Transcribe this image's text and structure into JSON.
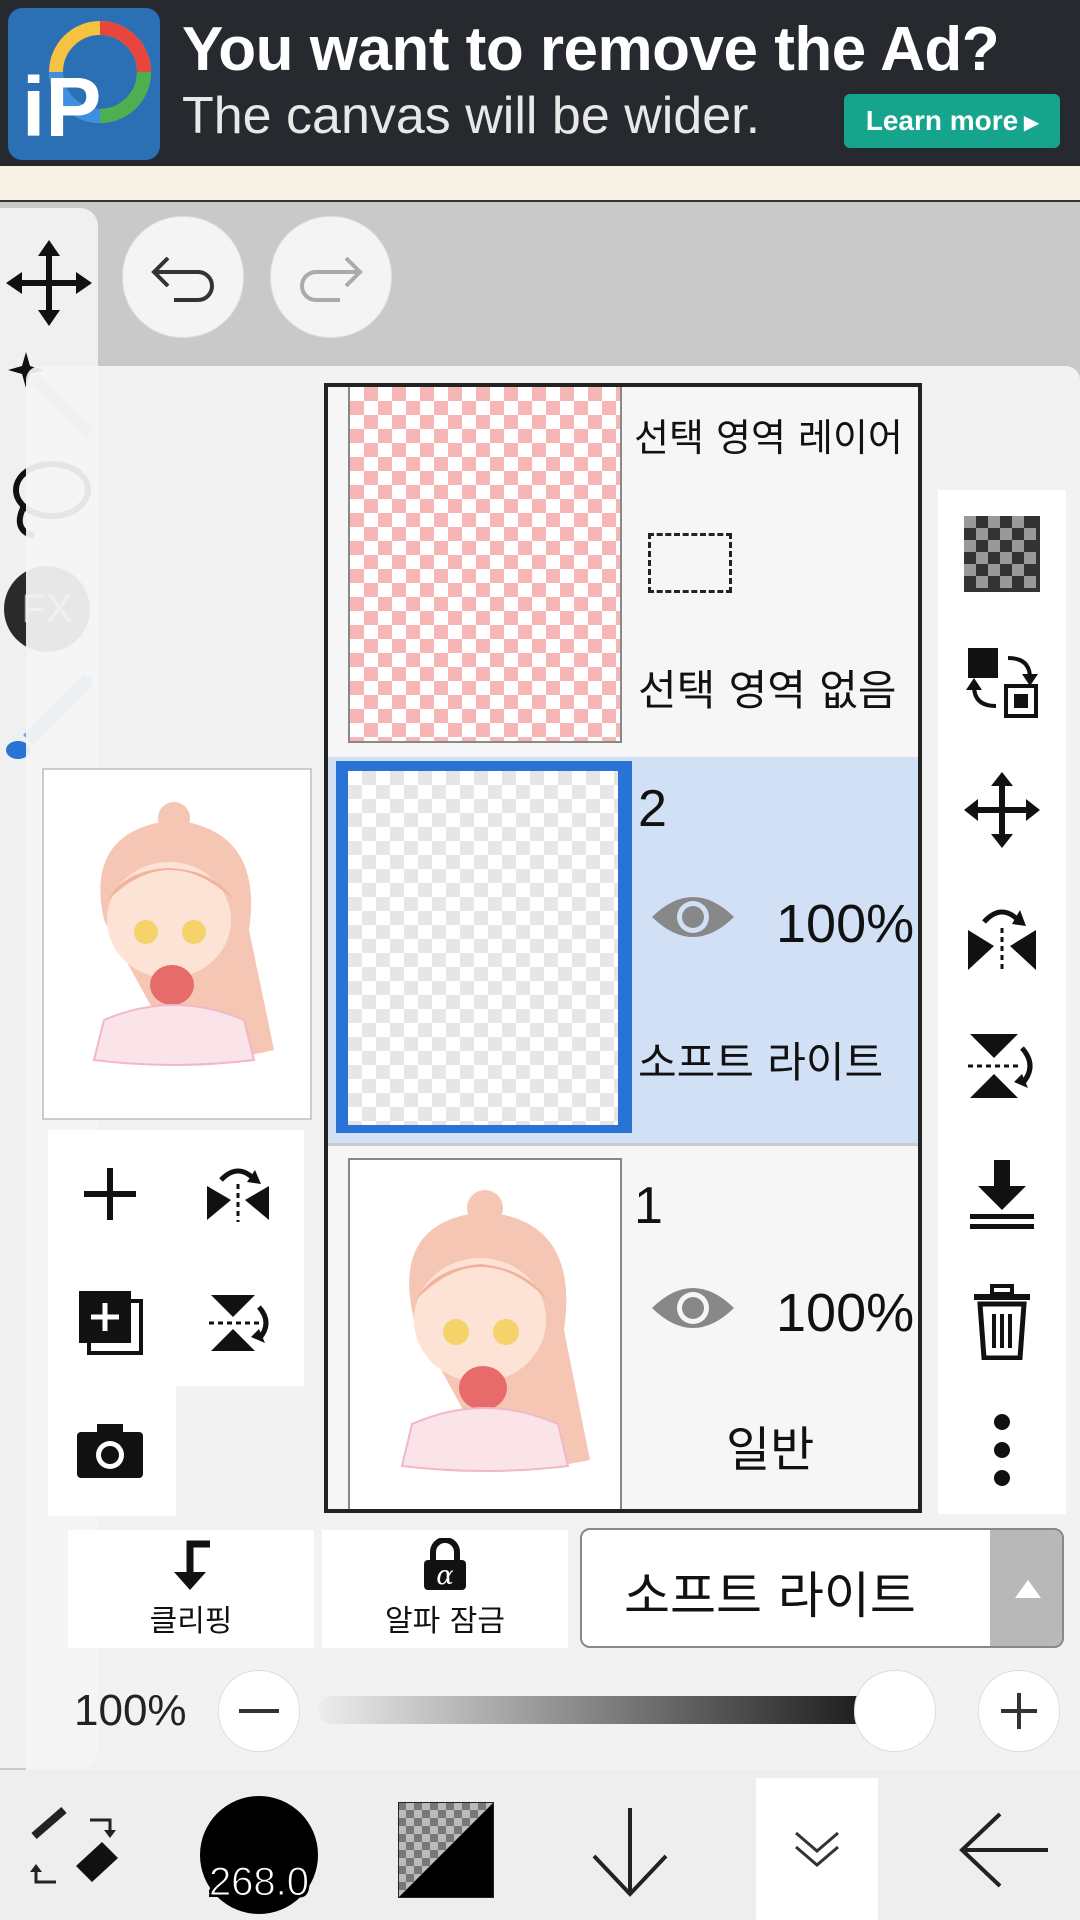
{
  "ad": {
    "title": "You want to remove the Ad?",
    "subtitle": "The canvas will be wider.",
    "learn_more": "Learn more",
    "logo_letters": "iP"
  },
  "left_tools": {
    "fx_label": "FX"
  },
  "layers": [
    {
      "name": "선택 영역 레이어",
      "status": "선택 영역 없음"
    },
    {
      "number": "2",
      "opacity": "100%",
      "blend_mode": "소프트 라이트",
      "selected": true
    },
    {
      "number": "1",
      "opacity": "100%",
      "blend_mode": "일반"
    }
  ],
  "options": {
    "clipping_label": "클리핑",
    "alpha_lock_label": "알파 잠금",
    "blend_mode_value": "소프트 라이트"
  },
  "opacity": {
    "label": "100%",
    "value": 1.0
  },
  "bottom": {
    "brush_size": "268.0"
  },
  "colors": {
    "selection_blue": "#2a73d6",
    "selected_row": "#d1e0f4",
    "ad_green": "#14a58c",
    "ad_bg": "#26292d"
  }
}
